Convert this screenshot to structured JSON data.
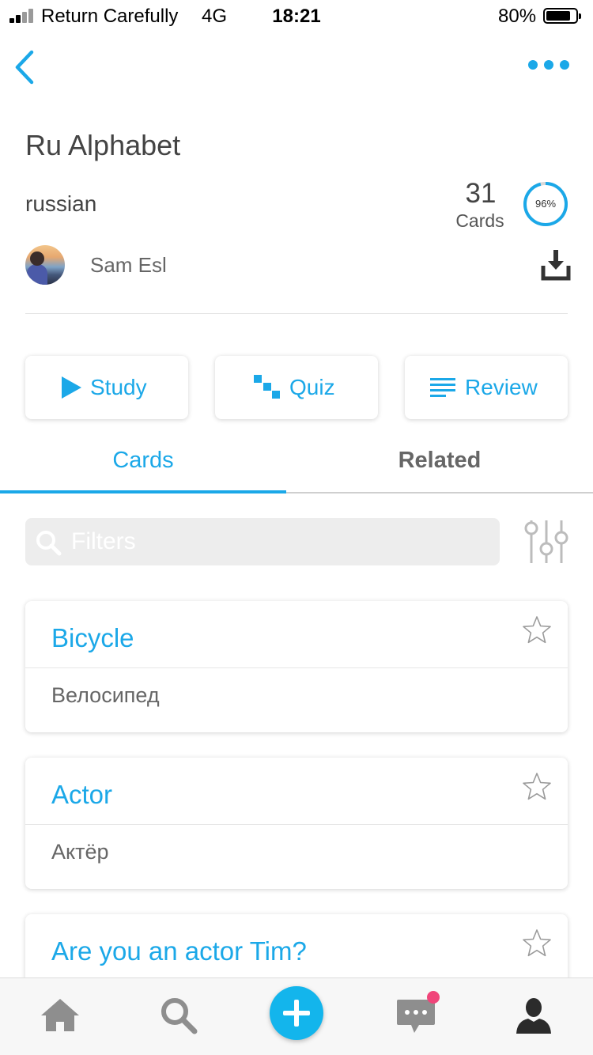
{
  "status_bar": {
    "carrier": "Return Carefully",
    "network": "4G",
    "time": "18:21",
    "battery_percent": "80%"
  },
  "deck": {
    "title": "Ru Alphabet",
    "language": "russian",
    "card_count": "31",
    "card_count_label": "Cards",
    "progress_label": "96%",
    "progress": 0.96,
    "author": "Sam Esl"
  },
  "modes": {
    "study": "Study",
    "quiz": "Quiz",
    "review": "Review"
  },
  "tabs": {
    "cards": "Cards",
    "related": "Related"
  },
  "filter": {
    "placeholder": "Filters"
  },
  "cards": [
    {
      "front": "Bicycle",
      "back": "Велосипед"
    },
    {
      "front": "Actor",
      "back": "Актёр"
    },
    {
      "front": "Are you an actor Tim?",
      "back": ""
    }
  ],
  "colors": {
    "accent": "#1ba8e8",
    "fab": "#13b5ec",
    "notification": "#f0457a",
    "text_dark": "#444444",
    "text_muted": "#666666"
  },
  "icons": {
    "back": "chevron-left-icon",
    "more": "more-dots-icon",
    "download": "download-icon",
    "study": "play-icon",
    "quiz": "quiz-blocks-icon",
    "review": "list-lines-icon",
    "search": "search-icon",
    "filter_settings": "sliders-icon",
    "favorite": "star-icon",
    "nav_home": "home-icon",
    "nav_search": "search-icon",
    "nav_add": "plus-icon",
    "nav_messages": "chat-icon",
    "nav_profile": "profile-icon"
  }
}
